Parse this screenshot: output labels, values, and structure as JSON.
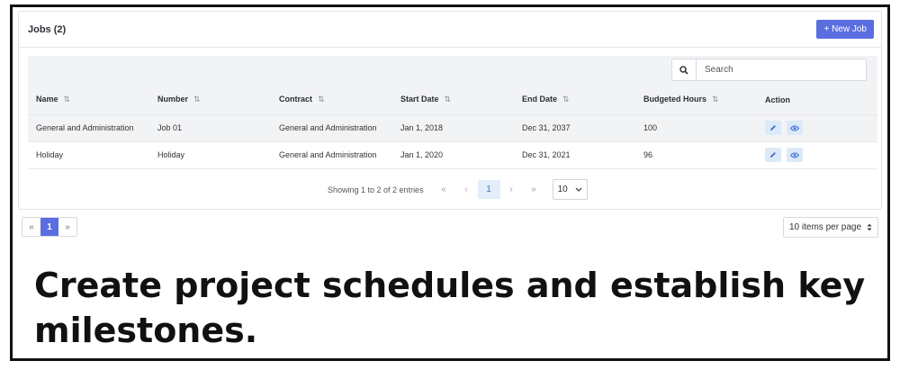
{
  "card": {
    "title": "Jobs (2)",
    "new_button": "+ New Job"
  },
  "search": {
    "placeholder": "Search"
  },
  "columns": [
    "Name",
    "Number",
    "Contract",
    "Start Date",
    "End Date",
    "Budgeted Hours",
    "Action"
  ],
  "sort_glyph": "⇅",
  "rows": [
    [
      "General and Administration",
      "Job 01",
      "General and Administration",
      "Jan 1, 2018",
      "Dec 31, 2037",
      "100"
    ],
    [
      "Holiday",
      "Holiday",
      "General and Administration",
      "Jan 1, 2020",
      "Dec 31, 2021",
      "96"
    ]
  ],
  "pagination": {
    "info": "Showing 1 to 2 of 2 entries",
    "first": "«",
    "prev": "‹",
    "current": "1",
    "next": "›",
    "last": "»",
    "page_size": "10"
  },
  "bottom": {
    "first": "«",
    "current": "1",
    "last": "»",
    "items_per_page": "10 items per page"
  },
  "caption": "Create project schedules and establish key milestones.",
  "colors": {
    "accent": "#5b6ee1",
    "action_bg": "#dce9f8",
    "header_bg": "#f2f3f5"
  }
}
